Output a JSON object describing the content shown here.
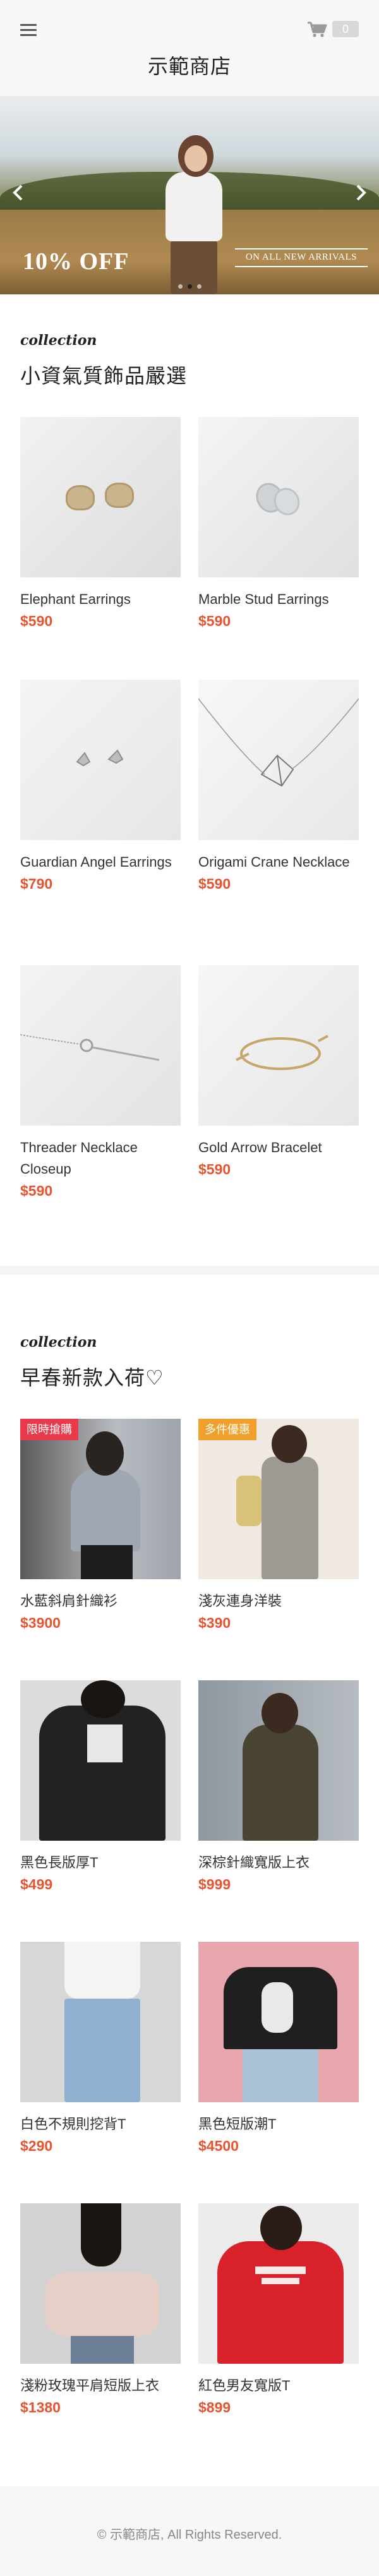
{
  "header": {
    "brand": "示範商店",
    "cart_count": "0"
  },
  "banner": {
    "promo_main": "10% OFF",
    "promo_sub": "ON ALL NEW ARRIVALS",
    "slide_count": 3,
    "active_slide": 1
  },
  "collection1": {
    "script_label": "collection",
    "title": "小資氣質飾品嚴選",
    "products": [
      {
        "name": "Elephant Earrings",
        "price": "$590"
      },
      {
        "name": "Marble Stud Earrings",
        "price": "$590"
      },
      {
        "name": "Guardian Angel Earrings",
        "price": "$790"
      },
      {
        "name": "Origami Crane Necklace",
        "price": "$590"
      },
      {
        "name": "Threader Necklace Closeup",
        "price": "$590"
      },
      {
        "name": "Gold Arrow Bracelet",
        "price": "$590"
      }
    ]
  },
  "collection2": {
    "script_label": "collection",
    "title": "早春新款入荷♡",
    "products": [
      {
        "name": "水藍斜肩針織衫",
        "price": "$3900",
        "badge": "限時搶購"
      },
      {
        "name": "淺灰連身洋裝",
        "price": "$390",
        "badge": "多件優惠"
      },
      {
        "name": "黑色長版厚T",
        "price": "$499"
      },
      {
        "name": "深棕針織寬版上衣",
        "price": "$999"
      },
      {
        "name": "白色不規則挖背T",
        "price": "$290"
      },
      {
        "name": "黑色短版潮T",
        "price": "$4500"
      },
      {
        "name": "淺粉玫瑰平肩短版上衣",
        "price": "$1380"
      },
      {
        "name": "紅色男友寬版T",
        "price": "$899"
      }
    ]
  },
  "footer": {
    "copyright": "© 示範商店, All Rights Reserved."
  },
  "colors": {
    "price": "#e8542f",
    "badge_red": "#e83a4a",
    "badge_orange": "#f0a02b",
    "header_bg": "#f7f7f8"
  }
}
